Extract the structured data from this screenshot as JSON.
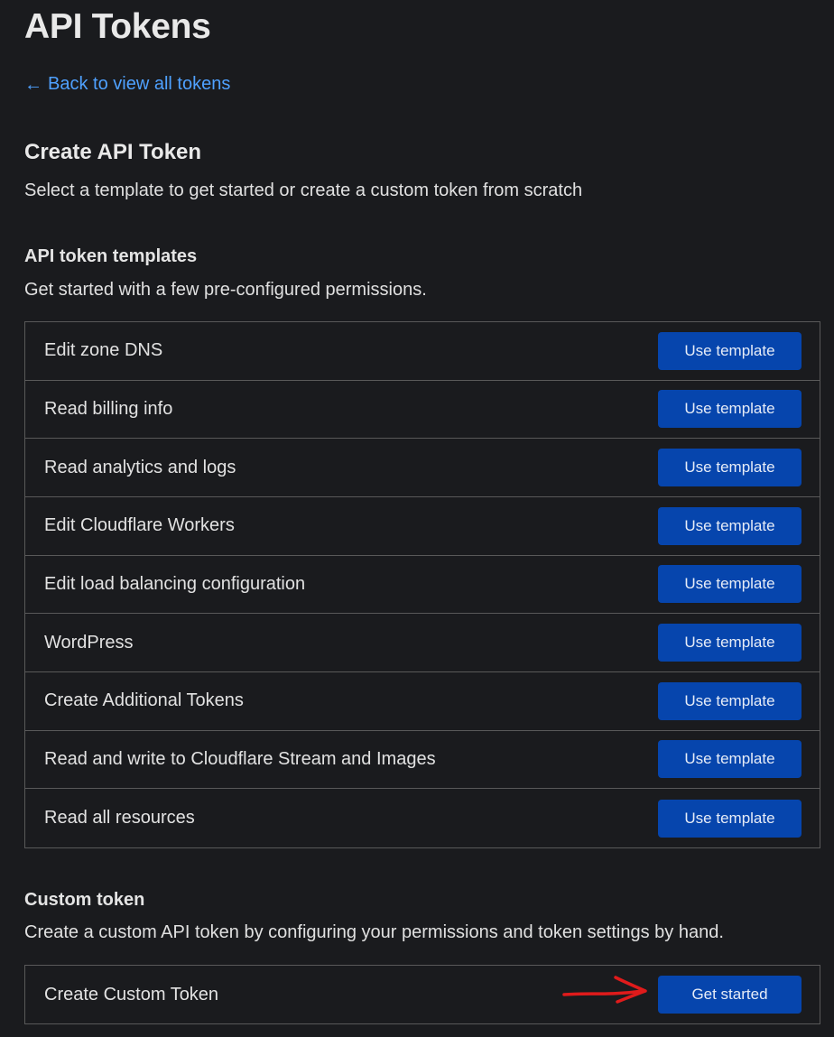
{
  "header": {
    "title": "API Tokens",
    "back_arrow": "←",
    "back_label": "Back to view all tokens"
  },
  "create": {
    "title": "Create API Token",
    "description": "Select a template to get started or create a custom token from scratch"
  },
  "templates": {
    "title": "API token templates",
    "description": "Get started with a few pre-configured permissions.",
    "button_label": "Use template",
    "items": [
      "Edit zone DNS",
      "Read billing info",
      "Read analytics and logs",
      "Edit Cloudflare Workers",
      "Edit load balancing configuration",
      "WordPress",
      "Create Additional Tokens",
      "Read and write to Cloudflare Stream and Images",
      "Read all resources"
    ]
  },
  "custom": {
    "title": "Custom token",
    "description": "Create a custom API token by configuring your permissions and token settings by hand.",
    "row_label": "Create Custom Token",
    "button_label": "Get started"
  },
  "colors": {
    "background": "#1a1b1e",
    "link": "#4fa1ff",
    "button": "#0645ad",
    "annotation_arrow": "#e01b1b"
  },
  "icons": {
    "back": "arrow-left-icon",
    "annotation": "red-arrow-annotation-icon"
  }
}
